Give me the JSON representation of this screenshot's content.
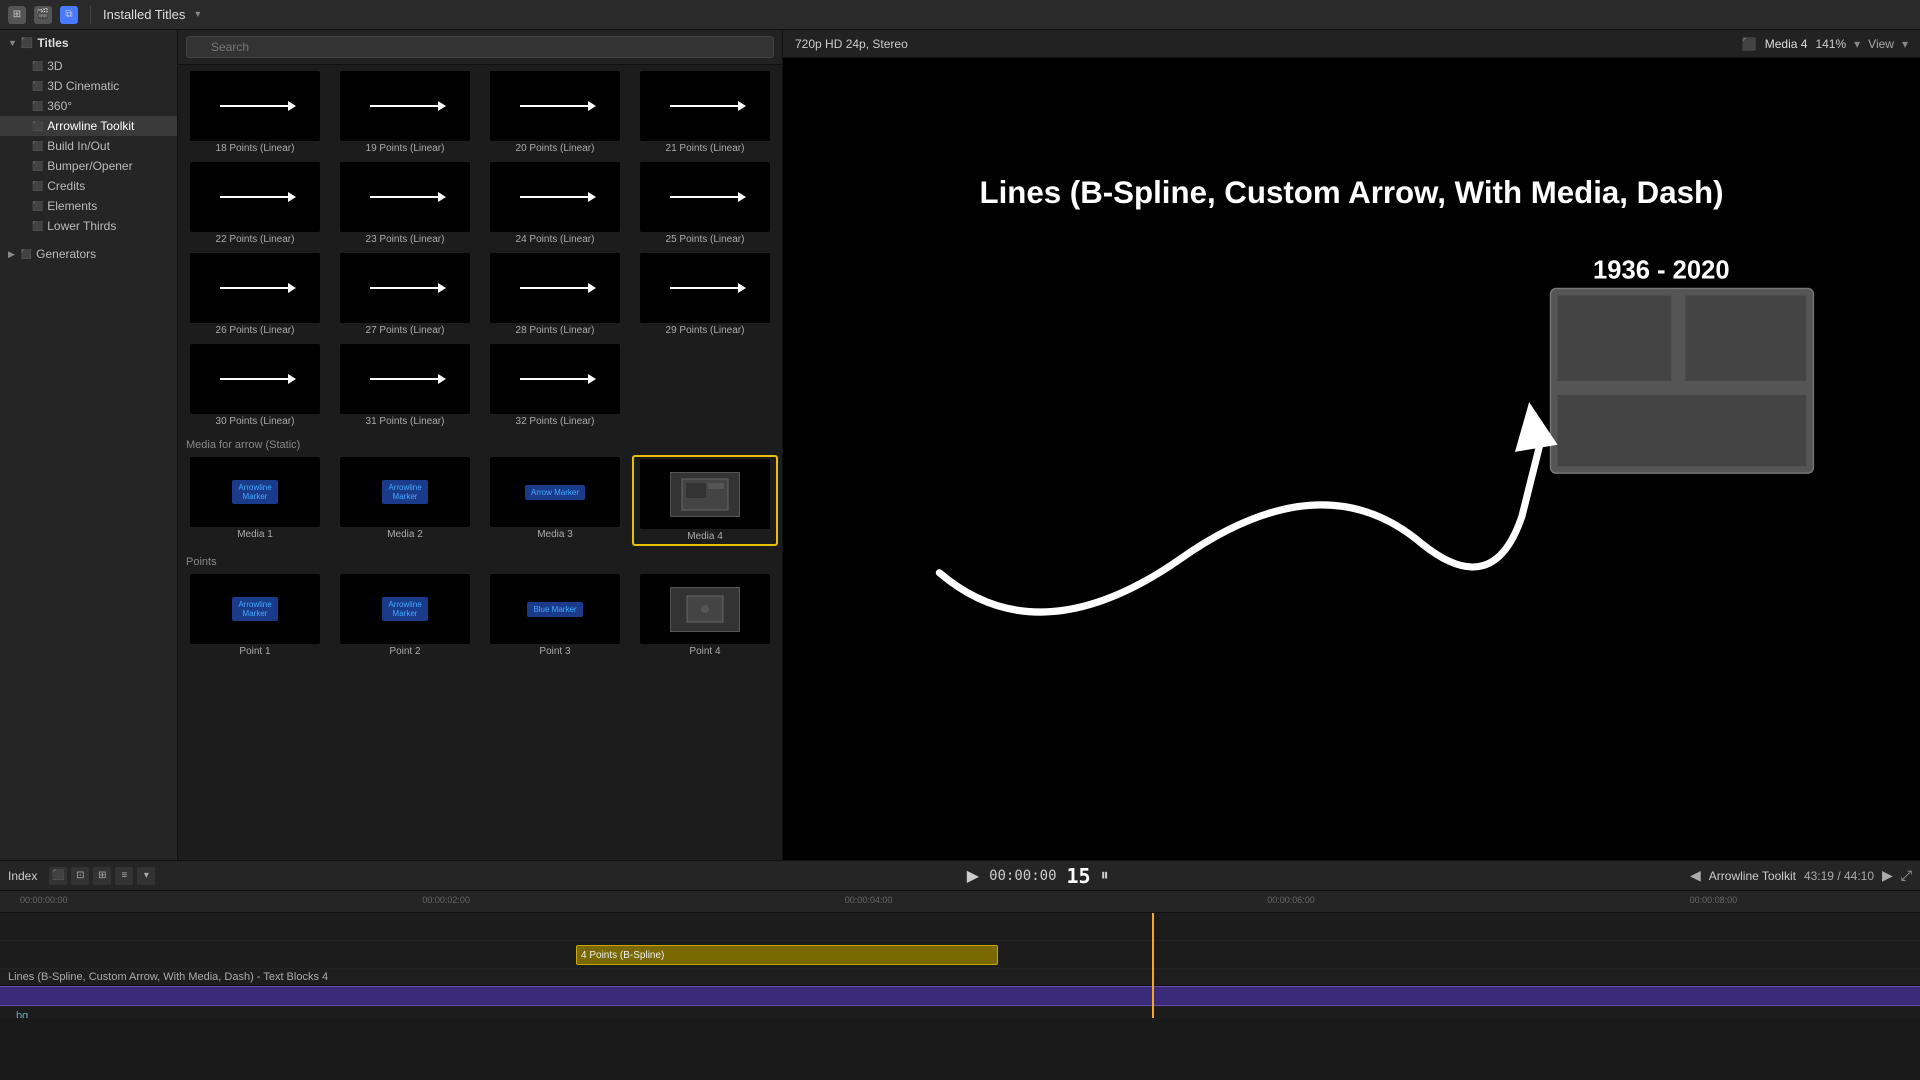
{
  "topbar": {
    "icons": [
      "grid",
      "film",
      "layers"
    ],
    "installed_titles": "Installed Titles",
    "dropdown_arrow": "▾"
  },
  "left_panel": {
    "titles_label": "Titles",
    "tree_items": [
      {
        "id": "3d",
        "label": "3D",
        "indent": 1,
        "type": "item"
      },
      {
        "id": "3d-cinematic",
        "label": "3D Cinematic",
        "indent": 1,
        "type": "item"
      },
      {
        "id": "360",
        "label": "360°",
        "indent": 1,
        "type": "item"
      },
      {
        "id": "arrowline-toolkit",
        "label": "Arrowline Toolkit",
        "indent": 1,
        "type": "item",
        "selected": true
      },
      {
        "id": "build-in-out",
        "label": "Build In/Out",
        "indent": 1,
        "type": "item"
      },
      {
        "id": "bumper-opener",
        "label": "Bumper/Opener",
        "indent": 1,
        "type": "item"
      },
      {
        "id": "credits",
        "label": "Credits",
        "indent": 1,
        "type": "item"
      },
      {
        "id": "elements",
        "label": "Elements",
        "indent": 1,
        "type": "item"
      },
      {
        "id": "lower-thirds",
        "label": "Lower Thirds",
        "indent": 1,
        "type": "item"
      }
    ],
    "generators_label": "Generators"
  },
  "middle_panel": {
    "search_placeholder": "Search",
    "sections": [
      {
        "label": "",
        "items": [
          {
            "label": "18 Points (Linear)",
            "type": "arrow"
          },
          {
            "label": "19 Points (Linear)",
            "type": "arrow"
          },
          {
            "label": "20 Points (Linear)",
            "type": "arrow"
          },
          {
            "label": "21 Points (Linear)",
            "type": "arrow"
          },
          {
            "label": "22 Points (Linear)",
            "type": "arrow"
          },
          {
            "label": "23 Points (Linear)",
            "type": "arrow"
          },
          {
            "label": "24 Points (Linear)",
            "type": "arrow"
          },
          {
            "label": "25 Points (Linear)",
            "type": "arrow"
          },
          {
            "label": "26 Points (Linear)",
            "type": "arrow"
          },
          {
            "label": "27 Points (Linear)",
            "type": "arrow"
          },
          {
            "label": "28 Points (Linear)",
            "type": "arrow"
          },
          {
            "label": "29 Points (Linear)",
            "type": "arrow"
          },
          {
            "label": "30 Points (Linear)",
            "type": "arrow"
          },
          {
            "label": "31 Points (Linear)",
            "type": "arrow"
          },
          {
            "label": "32 Points (Linear)",
            "type": "arrow"
          }
        ]
      },
      {
        "label": "Media for arrow (Static)",
        "items": [
          {
            "label": "Media 1",
            "type": "media_blue"
          },
          {
            "label": "Media 2",
            "type": "media_blue"
          },
          {
            "label": "Media 3",
            "type": "media_blue"
          },
          {
            "label": "Media 4",
            "type": "media_gray",
            "selected": true
          }
        ]
      },
      {
        "label": "Points",
        "items": [
          {
            "label": "Point 1",
            "type": "media_blue"
          },
          {
            "label": "Point 2",
            "type": "media_blue"
          },
          {
            "label": "Point 3",
            "type": "media_blue"
          },
          {
            "label": "Point 4",
            "type": "media_gray"
          }
        ]
      }
    ]
  },
  "preview": {
    "resolution": "720p HD 24p, Stereo",
    "title": "Media 4",
    "zoom": "141%",
    "view_label": "View",
    "graphic_title": "Lines (B-Spline, Custom Arrow, With Media, Dash)",
    "year_range": "1936 - 2020"
  },
  "playback": {
    "timecode": "00:00:00",
    "frame": "15",
    "track_name": "Arrowline Toolkit",
    "position": "43:19",
    "duration": "44:10"
  },
  "timeline": {
    "ruler_times": [
      "00:00:00:00",
      "00:00:02:00",
      "00:00:04:00",
      "00:00:06:00",
      "00:00:08:00"
    ],
    "clips": [
      {
        "label": "4 Points (B-Spline)",
        "color": "yellow",
        "left_pct": 30,
        "width_pct": 22
      },
      {
        "label": "Lines (B-Spline, Custom Arrow, With Media, Dash) - Text Blocks 4",
        "color": "purple",
        "left_pct": 0,
        "width_pct": 100
      }
    ],
    "bg_label": "bg"
  },
  "index_bar": {
    "label": "Index",
    "tool_icons": [
      "monitor",
      "crop",
      "transform",
      "layers",
      "arrow"
    ]
  }
}
